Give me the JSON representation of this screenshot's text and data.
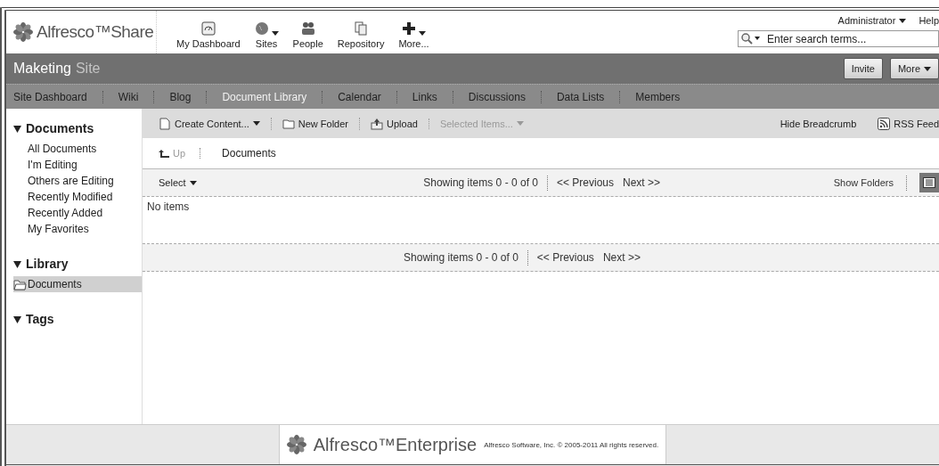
{
  "header": {
    "brand": "Alfresco™Share",
    "apps": [
      {
        "label": "My Dashboard",
        "kind": "dashboard",
        "has_menu": false
      },
      {
        "label": "Sites",
        "kind": "globe",
        "has_menu": true
      },
      {
        "label": "People",
        "kind": "people",
        "has_menu": false
      },
      {
        "label": "Repository",
        "kind": "repository",
        "has_menu": false
      },
      {
        "label": "More...",
        "kind": "plus",
        "has_menu": true
      }
    ],
    "user": "Administrator",
    "help": "Help",
    "search": {
      "placeholder": "Enter search terms..."
    }
  },
  "site": {
    "name": "Maketing",
    "suffix": "Site",
    "buttons": [
      {
        "label": "Invite",
        "has_menu": false
      },
      {
        "label": "More",
        "has_menu": true
      }
    ]
  },
  "site_nav": [
    {
      "label": "Site Dashboard",
      "selected": false
    },
    {
      "label": "Wiki",
      "selected": false
    },
    {
      "label": "Blog",
      "selected": false
    },
    {
      "label": "Document Library",
      "selected": true
    },
    {
      "label": "Calendar",
      "selected": false
    },
    {
      "label": "Links",
      "selected": false
    },
    {
      "label": "Discussions",
      "selected": false
    },
    {
      "label": "Data Lists",
      "selected": false
    },
    {
      "label": "Members",
      "selected": false
    }
  ],
  "sidebar": [
    {
      "title": "Documents",
      "expanded": true,
      "kind": "filters",
      "items": [
        {
          "label": "All Documents"
        },
        {
          "label": "I'm Editing"
        },
        {
          "label": "Others are Editing"
        },
        {
          "label": "Recently Modified"
        },
        {
          "label": "Recently Added"
        },
        {
          "label": "My Favorites"
        }
      ]
    },
    {
      "title": "Library",
      "expanded": true,
      "kind": "tree",
      "items": [
        {
          "label": "Documents",
          "selected": true
        }
      ]
    },
    {
      "title": "Tags",
      "expanded": true,
      "kind": "tags"
    }
  ],
  "toolbar": {
    "actions": [
      {
        "label": "Create Content...",
        "kind": "document",
        "has_menu": true,
        "disabled": false
      },
      {
        "label": "New Folder",
        "kind": "folder",
        "has_menu": false,
        "disabled": false
      },
      {
        "label": "Upload",
        "kind": "upload",
        "has_menu": false,
        "disabled": false
      },
      {
        "label": "Selected Items...",
        "kind": "plain",
        "has_menu": true,
        "disabled": true
      }
    ],
    "right": [
      {
        "label": "Hide Breadcrumb",
        "kind": "plain"
      },
      {
        "label": "RSS Feed",
        "kind": "rss"
      }
    ]
  },
  "breadcrumb": {
    "up": "Up",
    "up_disabled": true,
    "path": "Documents"
  },
  "list": {
    "select": "Select",
    "info": "Showing items 0 - 0 of 0",
    "previous": "<< Previous",
    "next": "Next >>",
    "show_folders": "Show Folders",
    "empty": "No items",
    "bottom_info": "Showing items 0 - 0 of 0",
    "bottom_previous": "<< Previous",
    "bottom_next": "Next >>"
  },
  "footer": {
    "brand": "Alfresco™Enterprise",
    "copyright": "Alfresco Software, Inc. © 2005-2011 All rights reserved."
  }
}
